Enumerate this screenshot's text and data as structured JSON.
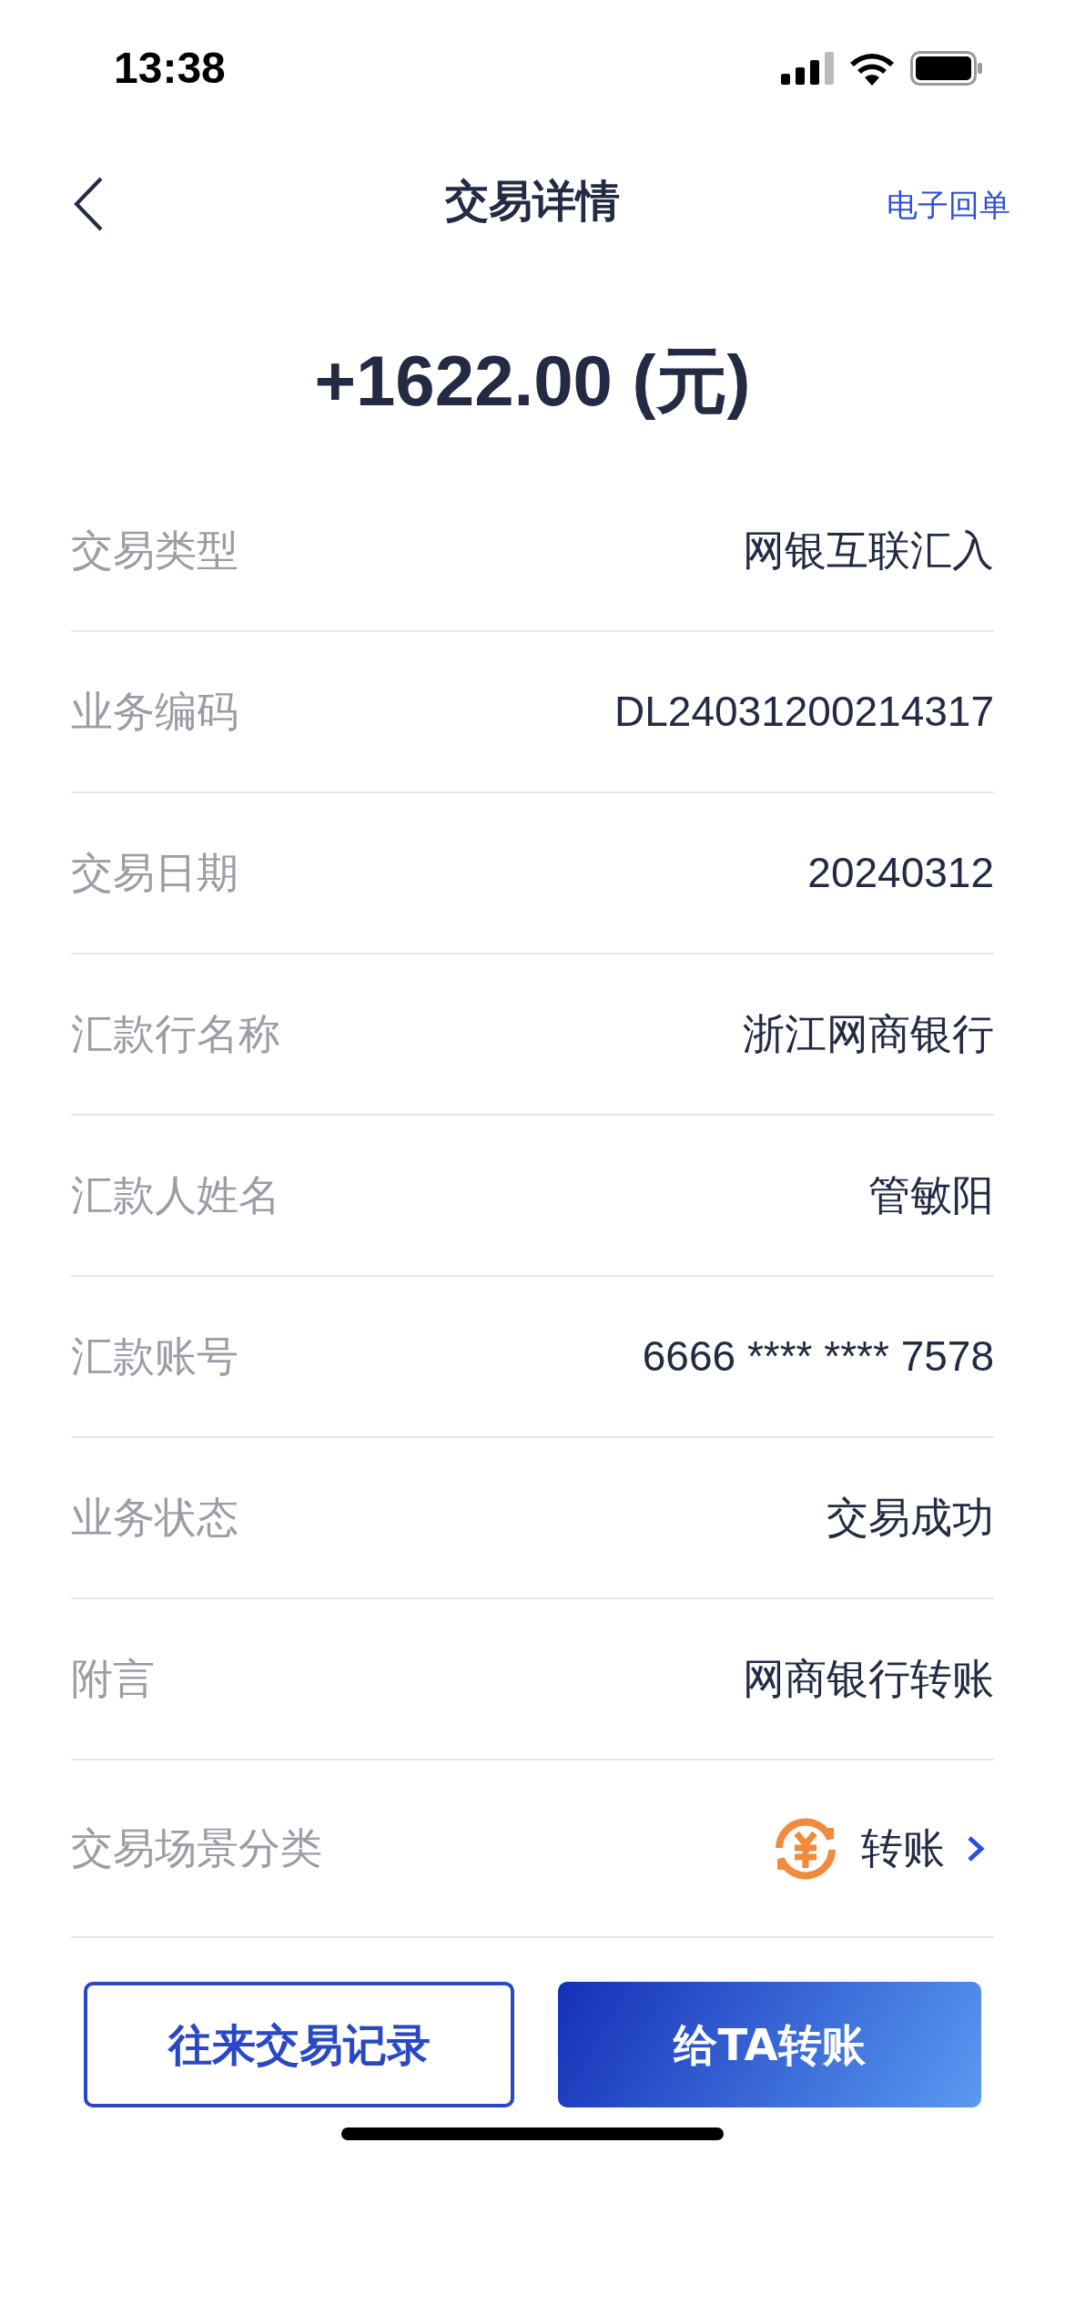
{
  "status_bar": {
    "time": "13:38"
  },
  "nav": {
    "title": "交易详情",
    "action": "电子回单"
  },
  "amount": "+1622.00 (元)",
  "rows": [
    {
      "kind": "text",
      "label": "交易类型",
      "value": "网银互联汇入"
    },
    {
      "kind": "text",
      "label": "业务编码",
      "value": "DL24031200214317"
    },
    {
      "kind": "text",
      "label": "交易日期",
      "value": "20240312"
    },
    {
      "kind": "text",
      "label": "汇款行名称",
      "value": "浙江网商银行"
    },
    {
      "kind": "text",
      "label": "汇款人姓名",
      "value": "管敏阳"
    },
    {
      "kind": "text",
      "label": "汇款账号",
      "value": "6666 **** **** 7578"
    },
    {
      "kind": "text",
      "label": "业务状态",
      "value": "交易成功"
    },
    {
      "kind": "text",
      "label": "附言",
      "value": "网商银行转账"
    },
    {
      "kind": "category",
      "label": "交易场景分类",
      "value": "转账"
    }
  ],
  "buttons": [
    {
      "kind": "outline",
      "label": "往来交易记录"
    },
    {
      "kind": "primary",
      "label": "给TA转账"
    }
  ]
}
